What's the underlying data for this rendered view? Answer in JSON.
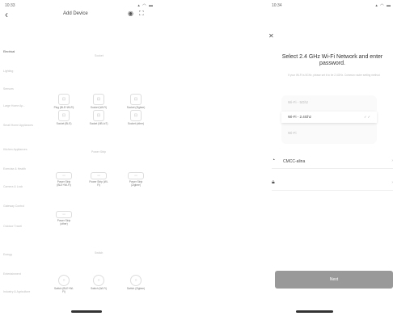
{
  "left_phone": {
    "status_time": "10:33",
    "title": "Add Device",
    "sidebar": {
      "items": [
        {
          "label": "Electrical",
          "active": true
        },
        {
          "label": "Lighting",
          "active": false
        },
        {
          "label": "Sensors",
          "active": false
        },
        {
          "label": "Large Home Ap...",
          "active": false
        },
        {
          "label": "Small Home Appliances",
          "active": false
        },
        {
          "label": "Kitchen Appliances",
          "active": false
        },
        {
          "label": "Exercise & Health",
          "active": false
        },
        {
          "label": "Camera & Lock",
          "active": false
        },
        {
          "label": "Gateway Control",
          "active": false
        },
        {
          "label": "Outdoor Travel",
          "active": false
        },
        {
          "label": "Energy",
          "active": false
        },
        {
          "label": "Entertainment",
          "active": false
        },
        {
          "label": "Industry & Agriculture",
          "active": false
        }
      ]
    },
    "sections": [
      {
        "title": "Socket",
        "devices": [
          {
            "label": "Plug (BLE+Wi-Fi)",
            "icon": "⊡"
          },
          {
            "label": "Socket (Wi-Fi)",
            "icon": "⊡"
          },
          {
            "label": "Socket (Zigbee)",
            "icon": "⊡"
          },
          {
            "label": "Socket (BLE)",
            "icon": "⊡"
          },
          {
            "label": "Socket (NB-IoT)",
            "icon": "⊡"
          },
          {
            "label": "Socket (other)",
            "icon": "⊡"
          }
        ]
      },
      {
        "title": "Power Strip",
        "devices": [
          {
            "label": "Power Strip (BLE+Wi-Fi)",
            "icon": "▭"
          },
          {
            "label": "Power Strip (Wi-Fi)",
            "icon": "▭"
          },
          {
            "label": "Power Strip (Zigbee)",
            "icon": "▭"
          },
          {
            "label": "Power Strip (other)",
            "icon": "▭"
          }
        ]
      },
      {
        "title": "Switch",
        "devices": [
          {
            "label": "Switch (BLE+Wi-Fi)",
            "icon": "○"
          },
          {
            "label": "Switch (Wi-Fi)",
            "icon": "○"
          },
          {
            "label": "Switch (Zigbee)",
            "icon": "○"
          }
        ]
      }
    ]
  },
  "right_phone": {
    "status_time": "10:34",
    "heading": "Select 2.4 GHz Wi-Fi Network and enter password.",
    "subtext": "If your Wi-Fi is 5GHz, please set it to be 2.4GHz. Common router setting method",
    "bands": [
      {
        "label": "Wi-Fi - 5Ghz",
        "active": false
      },
      {
        "label": "Wi-Fi - 2.4Ghz",
        "active": true
      },
      {
        "label": "Wi-Fi",
        "active": false
      }
    ],
    "wifi_field": {
      "value": "CMCC-alina"
    },
    "password_field": {
      "value": ""
    },
    "next_label": "Next"
  }
}
